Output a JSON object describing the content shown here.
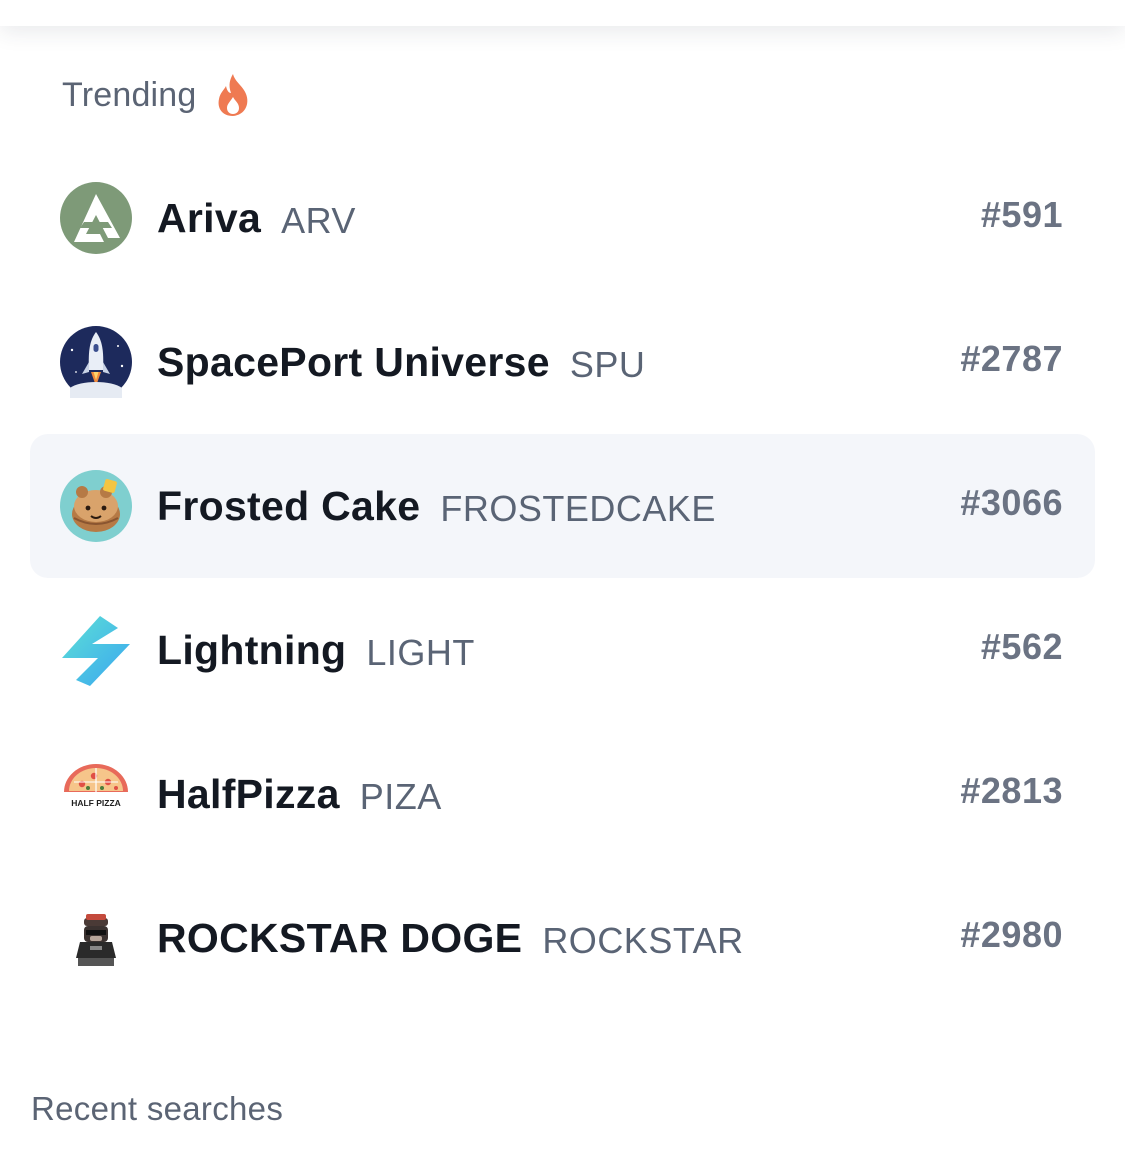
{
  "trending": {
    "title": "Trending",
    "icon": "fire-icon",
    "accent_color": "#ef7a52",
    "items": [
      {
        "name": "Ariva",
        "symbol": "ARV",
        "rank": "#591",
        "icon": "ariva-logo-icon"
      },
      {
        "name": "SpacePort Universe",
        "symbol": "SPU",
        "rank": "#2787",
        "icon": "spaceport-logo-icon"
      },
      {
        "name": "Frosted Cake",
        "symbol": "FROSTEDCAKE",
        "rank": "#3066",
        "icon": "frosted-cake-logo-icon",
        "highlighted": true
      },
      {
        "name": "Lightning",
        "symbol": "LIGHT",
        "rank": "#562",
        "icon": "lightning-logo-icon"
      },
      {
        "name": "HalfPizza",
        "symbol": "PIZA",
        "rank": "#2813",
        "icon": "halfpizza-logo-icon",
        "logo_text": "HALF PIZZA"
      },
      {
        "name": "ROCKSTAR DOGE",
        "symbol": "ROCKSTAR",
        "rank": "#2980",
        "icon": "rockstar-doge-logo-icon"
      }
    ]
  },
  "recent": {
    "title": "Recent searches"
  },
  "colors": {
    "highlight_bg": "#f4f6fa",
    "name_text": "#141922",
    "muted_text": "#5a6475"
  }
}
